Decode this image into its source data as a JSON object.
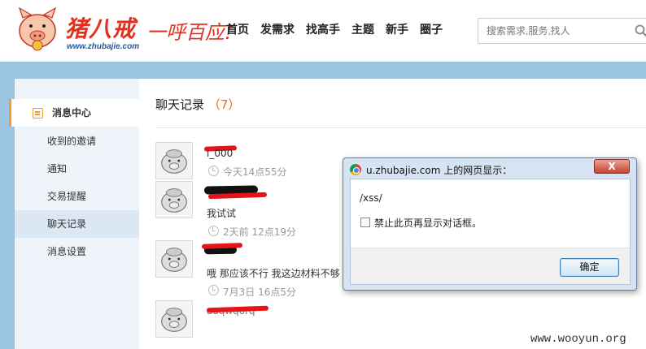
{
  "header": {
    "brand_text": "猪八戒",
    "site_url": "www.zhubajie.com",
    "slogan": "一呼百应!",
    "nav": [
      "首页",
      "发需求",
      "找高手",
      "主题",
      "新手",
      "圈子"
    ],
    "search_placeholder": "搜索需求,服务,找人"
  },
  "sidebar": {
    "header": "消息中心",
    "items": [
      "收到的邀请",
      "通知",
      "交易提醒",
      "聊天记录",
      "消息设置"
    ],
    "selected": "聊天记录"
  },
  "main": {
    "title": "聊天记录",
    "count_open": "（",
    "count": "7",
    "count_close": "）",
    "chats": [
      {
        "name_partial": "i_000",
        "message": "",
        "time": "今天14点55分"
      },
      {
        "name_partial": "",
        "message": "我试试",
        "time": "2天前 12点19分"
      },
      {
        "name_partial": "",
        "message": "哦 那应该不行 我这边材料不够",
        "time": "7月3日 16点5分"
      },
      {
        "name_partial": "aaqwqorq",
        "message": "",
        "time": ""
      }
    ]
  },
  "dialog": {
    "title": "u.zhubajie.com 上的网页显示：",
    "close_label": "X",
    "message": "/xss/",
    "checkbox_label": "禁止此页再显示对话框。",
    "ok_label": "确定"
  },
  "watermark": "www.wooyun.org"
}
